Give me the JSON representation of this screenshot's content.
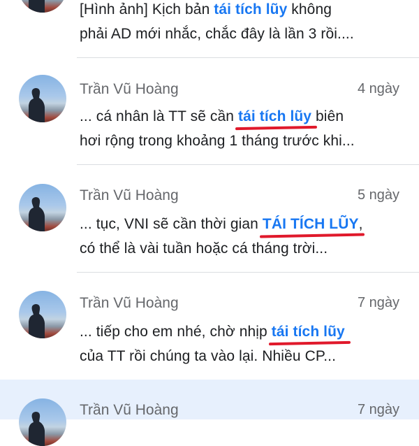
{
  "messages": [
    {
      "sender": "",
      "time": "",
      "line1": {
        "pre": "[Hình ảnh] Kịch bản ",
        "kw": "tái tích lũy",
        "post": " không"
      },
      "line2": "phải AD mới nhắc, chắc đây là lần 3 rồi....",
      "underlined": false,
      "highlighted": false
    },
    {
      "sender": "Trần Vũ Hoàng",
      "time": "4 ngày",
      "line1": {
        "pre": "... cá nhân là TT sẽ cần ",
        "kw": "tái tích lũy",
        "post": " biên"
      },
      "line2": "hơi rộng trong khoảng 1 tháng trước khi...",
      "underlined": true,
      "highlighted": false
    },
    {
      "sender": "Trần Vũ Hoàng",
      "time": "5 ngày",
      "line1": {
        "pre": "... tục, VNI sẽ cần thời gian ",
        "kw": "TÁI TÍCH LŨY",
        "post": ","
      },
      "line2": "có thể là vài tuần hoặc cá tháng trời...",
      "underlined": true,
      "highlighted": false
    },
    {
      "sender": "Trần Vũ Hoàng",
      "time": "7 ngày",
      "line1": {
        "pre": "... tiếp cho em nhé, chờ nhịp ",
        "kw": "tái tích lũy",
        "post": ""
      },
      "line2": "của TT rồi chúng ta vào lại. Nhiều CP...",
      "underlined": true,
      "highlighted": false
    },
    {
      "sender": "Trần Vũ Hoàng",
      "time": "7 ngày",
      "line1": {
        "pre": "",
        "kw": "",
        "post": ""
      },
      "line2": "",
      "underlined": false,
      "highlighted": true
    }
  ],
  "colors": {
    "keyword": "#1877f2",
    "underline": "#e0192b",
    "highlight": "#e7f0fd",
    "meta": "#65676b"
  }
}
